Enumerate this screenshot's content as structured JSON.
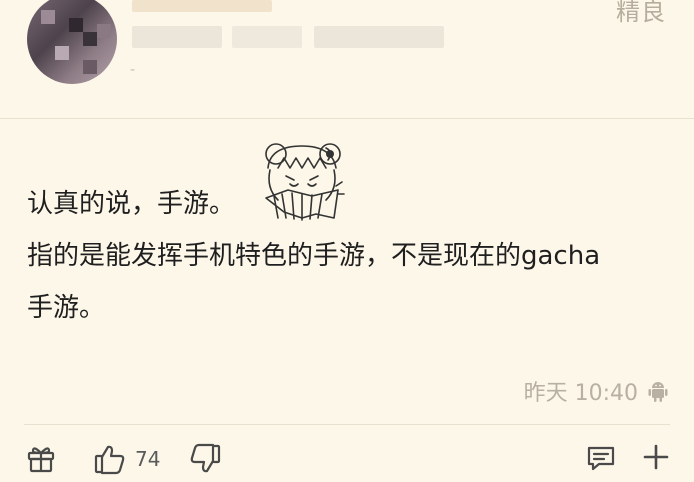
{
  "header": {
    "tag": "精良",
    "author_meta": "-"
  },
  "post": {
    "line1": "认真的说，手游。",
    "line2": "指的是能发挥手机特色的手游，不是现在的gacha",
    "line3": "手游。",
    "sticker_icon": "anime-girl-sticker"
  },
  "meta": {
    "timestamp": "昨天 10:40",
    "platform_icon": "android-icon"
  },
  "actions": {
    "like_count": "74"
  },
  "colors": {
    "background": "#fcf7e9",
    "muted_text": "#b8b0a2",
    "body_text": "#1f1f1f"
  }
}
